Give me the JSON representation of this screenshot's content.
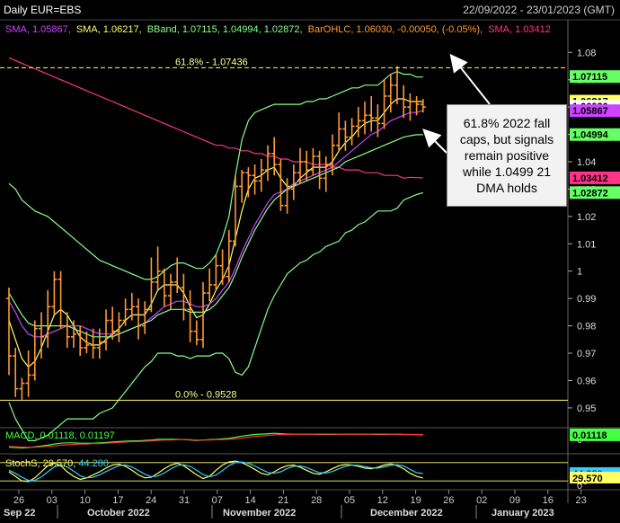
{
  "header": {
    "title": "Daily EUR=EBS",
    "date_range": "22/09/2022 - 23/01/2023 (GMT)"
  },
  "legend": [
    {
      "text": "SMA, 1.05867,",
      "color": "#cc44ff"
    },
    {
      "text": "SMA, 1.06217,",
      "color": "#ffff66"
    },
    {
      "text": "BBand, 1.07115, 1.04994, 1.02872,",
      "color": "#88ff88"
    },
    {
      "text": "BarOHLC, 1.06030, -0.00050, (-0.05%),",
      "color": "#ff9933"
    },
    {
      "text": "SMA, 1.03412",
      "color": "#ff3388"
    }
  ],
  "annotation": {
    "text": "61.8% 2022 fall caps, but signals remain positive while 1.0499 21 DMA holds"
  },
  "price_badges": [
    {
      "label": "1.07115",
      "value": 1.07115,
      "bg": "#66ff66",
      "fg": "#000000"
    },
    {
      "label": "1.06217",
      "value": 1.06217,
      "bg": "#ffff66",
      "fg": "#000000"
    },
    {
      "label": "1.06030",
      "value": 1.0603,
      "bg": "#ffffff",
      "fg": "#000000"
    },
    {
      "label": "1.05867",
      "value": 1.05867,
      "bg": "#cc44ff",
      "fg": "#000000"
    },
    {
      "label": "1.04994",
      "value": 1.04994,
      "bg": "#66ff66",
      "fg": "#000000"
    },
    {
      "label": "1.03412",
      "value": 1.03412,
      "bg": "#ff3388",
      "fg": "#000000"
    },
    {
      "label": "1.02872",
      "value": 1.02872,
      "bg": "#66ff66",
      "fg": "#000000"
    }
  ],
  "macd": {
    "label": "MACD, 0.01118, 0.01197",
    "label_color": "#44ff44",
    "value_label": "0.01118",
    "value_color": "#44ff44",
    "tick": "0"
  },
  "stoch": {
    "label_a": "StochS, 29.570,",
    "label_b": "44.280",
    "color_a": "#ffff66",
    "color_b": "#33ccff",
    "badge_a": "29.570",
    "badge_b": "44.280",
    "ticks": [
      "20",
      "0"
    ]
  },
  "colors": {
    "candles": "#ff9933",
    "sma_short": "#ffff66",
    "sma_mid": "#cc44ff",
    "sma_long": "#ff3388",
    "bband": "#88ff88",
    "fib": "#ffff66"
  },
  "chart_data": {
    "type": "line",
    "title": "Daily EUR=EBS",
    "ylim": [
      0.948,
      1.086
    ],
    "y_ticks": [
      "1.08",
      "1.07",
      "1.06",
      "1.05",
      "1.04",
      "1.03",
      "1.02",
      "1.01",
      "1",
      "0.99",
      "0.98",
      "0.97",
      "0.96",
      "0.95"
    ],
    "x_day_labels": [
      "26",
      "03",
      "10",
      "17",
      "24",
      "31",
      "07",
      "14",
      "21",
      "28",
      "05",
      "12",
      "19",
      "26",
      "02",
      "09",
      "16",
      "23"
    ],
    "x_month_labels": [
      "Sep 22",
      "October 2022",
      "November 2022",
      "December 2022",
      "January 2023"
    ],
    "fib_levels": [
      {
        "label": "61.8% - 1.07436",
        "value": 1.07436
      },
      {
        "label": "0.0% - 0.9528",
        "value": 0.9528
      }
    ],
    "ohlc": [
      [
        0.99,
        0.994,
        0.962,
        0.969
      ],
      [
        0.969,
        0.972,
        0.954,
        0.957
      ],
      [
        0.957,
        0.961,
        0.953,
        0.959
      ],
      [
        0.959,
        0.971,
        0.954,
        0.962
      ],
      [
        0.962,
        0.982,
        0.96,
        0.979
      ],
      [
        0.979,
        0.985,
        0.968,
        0.976
      ],
      [
        0.976,
        0.993,
        0.972,
        0.987
      ],
      [
        0.987,
        1.0,
        0.984,
        0.997
      ],
      [
        0.997,
        1.0,
        0.979,
        0.98
      ],
      [
        0.98,
        0.985,
        0.972,
        0.976
      ],
      [
        0.976,
        0.982,
        0.972,
        0.977
      ],
      [
        0.977,
        0.98,
        0.969,
        0.972
      ],
      [
        0.972,
        0.978,
        0.97,
        0.973
      ],
      [
        0.973,
        0.979,
        0.968,
        0.972
      ],
      [
        0.972,
        0.979,
        0.968,
        0.974
      ],
      [
        0.974,
        0.986,
        0.971,
        0.982
      ],
      [
        0.982,
        0.987,
        0.975,
        0.978
      ],
      [
        0.978,
        0.985,
        0.974,
        0.982
      ],
      [
        0.982,
        0.99,
        0.98,
        0.986
      ],
      [
        0.986,
        0.992,
        0.982,
        0.987
      ],
      [
        0.987,
        0.99,
        0.975,
        0.98
      ],
      [
        0.98,
        0.989,
        0.977,
        0.986
      ],
      [
        0.986,
        1.005,
        0.985,
        0.996
      ],
      [
        0.996,
        1.009,
        0.993,
        1.0
      ],
      [
        1.0,
        1.001,
        0.987,
        0.991
      ],
      [
        0.991,
        0.999,
        0.986,
        0.996
      ],
      [
        0.996,
        1.005,
        0.992,
        0.994
      ],
      [
        0.994,
        0.999,
        0.982,
        0.986
      ],
      [
        0.986,
        0.993,
        0.974,
        0.978
      ],
      [
        0.978,
        0.982,
        0.973,
        0.975
      ],
      [
        0.975,
        0.996,
        0.972,
        0.992
      ],
      [
        0.992,
        1.001,
        0.989,
        0.995
      ],
      [
        0.995,
        1.006,
        0.993,
        1.002
      ],
      [
        1.002,
        1.008,
        0.995,
        0.998
      ],
      [
        0.998,
        1.015,
        0.996,
        1.011
      ],
      [
        1.011,
        1.035,
        1.009,
        1.031
      ],
      [
        1.031,
        1.037,
        1.025,
        1.036
      ],
      [
        1.036,
        1.038,
        1.027,
        1.035
      ],
      [
        1.035,
        1.039,
        1.028,
        1.033
      ],
      [
        1.033,
        1.041,
        1.029,
        1.037
      ],
      [
        1.037,
        1.046,
        1.033,
        1.043
      ],
      [
        1.043,
        1.049,
        1.035,
        1.039
      ],
      [
        1.039,
        1.041,
        1.022,
        1.024
      ],
      [
        1.024,
        1.034,
        1.021,
        1.03
      ],
      [
        1.03,
        1.039,
        1.026,
        1.036
      ],
      [
        1.036,
        1.045,
        1.032,
        1.04
      ],
      [
        1.04,
        1.044,
        1.033,
        1.037
      ],
      [
        1.037,
        1.045,
        1.035,
        1.042
      ],
      [
        1.042,
        1.044,
        1.03,
        1.034
      ],
      [
        1.034,
        1.042,
        1.029,
        1.039
      ],
      [
        1.039,
        1.05,
        1.035,
        1.046
      ],
      [
        1.046,
        1.058,
        1.044,
        1.052
      ],
      [
        1.052,
        1.055,
        1.044,
        1.049
      ],
      [
        1.049,
        1.056,
        1.046,
        1.053
      ],
      [
        1.053,
        1.06,
        1.049,
        1.055
      ],
      [
        1.055,
        1.062,
        1.05,
        1.057
      ],
      [
        1.057,
        1.064,
        1.051,
        1.056
      ],
      [
        1.056,
        1.061,
        1.049,
        1.054
      ],
      [
        1.054,
        1.07,
        1.052,
        1.064
      ],
      [
        1.064,
        1.072,
        1.058,
        1.068
      ],
      [
        1.068,
        1.075,
        1.061,
        1.063
      ],
      [
        1.063,
        1.068,
        1.056,
        1.06
      ],
      [
        1.06,
        1.065,
        1.055,
        1.062
      ],
      [
        1.062,
        1.064,
        1.057,
        1.061
      ],
      [
        1.061,
        1.063,
        1.058,
        1.06
      ]
    ],
    "series": [
      {
        "name": "SMA, 1.06217",
        "color": "#ffff66",
        "values": [
          0.982,
          0.975,
          0.968,
          0.965,
          0.967,
          0.972,
          0.978,
          0.984,
          0.986,
          0.984,
          0.98,
          0.976,
          0.974,
          0.973,
          0.973,
          0.975,
          0.977,
          0.979,
          0.982,
          0.984,
          0.984,
          0.984,
          0.988,
          0.993,
          0.995,
          0.995,
          0.995,
          0.992,
          0.987,
          0.983,
          0.984,
          0.988,
          0.993,
          0.997,
          1.002,
          1.012,
          1.022,
          1.03,
          1.034,
          1.035,
          1.037,
          1.038,
          1.034,
          1.031,
          1.031,
          1.034,
          1.036,
          1.038,
          1.038,
          1.038,
          1.04,
          1.044,
          1.047,
          1.049,
          1.052,
          1.054,
          1.055,
          1.055,
          1.058,
          1.061,
          1.063,
          1.063,
          1.062,
          1.062,
          1.062
        ]
      },
      {
        "name": "SMA, 1.05867",
        "color": "#cc44ff",
        "values": [
          0.989,
          0.985,
          0.98,
          0.977,
          0.976,
          0.976,
          0.977,
          0.978,
          0.979,
          0.98,
          0.98,
          0.98,
          0.979,
          0.978,
          0.977,
          0.977,
          0.977,
          0.977,
          0.978,
          0.979,
          0.98,
          0.981,
          0.983,
          0.985,
          0.987,
          0.988,
          0.989,
          0.989,
          0.988,
          0.987,
          0.987,
          0.988,
          0.99,
          0.993,
          0.996,
          1.001,
          1.007,
          1.012,
          1.017,
          1.021,
          1.025,
          1.028,
          1.029,
          1.03,
          1.032,
          1.033,
          1.034,
          1.035,
          1.036,
          1.037,
          1.038,
          1.04,
          1.042,
          1.044,
          1.046,
          1.048,
          1.05,
          1.051,
          1.053,
          1.055,
          1.056,
          1.057,
          1.058,
          1.058,
          1.0587
        ]
      },
      {
        "name": "SMA, 1.03412",
        "color": "#ff3388",
        "values": [
          1.078,
          1.077,
          1.076,
          1.075,
          1.074,
          1.073,
          1.072,
          1.071,
          1.07,
          1.069,
          1.068,
          1.067,
          1.066,
          1.065,
          1.064,
          1.063,
          1.062,
          1.061,
          1.06,
          1.059,
          1.058,
          1.057,
          1.056,
          1.055,
          1.054,
          1.053,
          1.052,
          1.051,
          1.05,
          1.049,
          1.048,
          1.047,
          1.046,
          1.046,
          1.045,
          1.045,
          1.044,
          1.044,
          1.043,
          1.043,
          1.042,
          1.042,
          1.041,
          1.041,
          1.04,
          1.04,
          1.04,
          1.039,
          1.039,
          1.039,
          1.038,
          1.038,
          1.037,
          1.037,
          1.037,
          1.036,
          1.036,
          1.036,
          1.035,
          1.035,
          1.035,
          1.034,
          1.0343,
          1.0342,
          1.0341
        ]
      },
      {
        "name": "BBand upper",
        "color": "#88ff88",
        "values": [
          1.032,
          1.03,
          1.026,
          1.024,
          1.022,
          1.021,
          1.02,
          1.018,
          1.016,
          1.014,
          1.012,
          1.01,
          1.008,
          1.006,
          1.004,
          1.003,
          1.002,
          1.001,
          1.0,
          0.999,
          0.998,
          0.997,
          0.997,
          0.998,
          1.0,
          1.002,
          1.003,
          1.003,
          1.002,
          1.001,
          1.001,
          1.003,
          1.006,
          1.012,
          1.02,
          1.035,
          1.048,
          1.055,
          1.058,
          1.059,
          1.06,
          1.061,
          1.061,
          1.061,
          1.061,
          1.061,
          1.062,
          1.062,
          1.063,
          1.063,
          1.064,
          1.065,
          1.066,
          1.067,
          1.067,
          1.068,
          1.068,
          1.068,
          1.07,
          1.072,
          1.073,
          1.072,
          1.072,
          1.071,
          1.071
        ]
      },
      {
        "name": "BBand middle",
        "color": "#88ff88",
        "values": [
          0.992,
          0.988,
          0.984,
          0.981,
          0.98,
          0.98,
          0.98,
          0.98,
          0.98,
          0.98,
          0.979,
          0.978,
          0.977,
          0.976,
          0.976,
          0.976,
          0.976,
          0.977,
          0.978,
          0.979,
          0.98,
          0.981,
          0.982,
          0.984,
          0.985,
          0.986,
          0.986,
          0.986,
          0.985,
          0.985,
          0.985,
          0.986,
          0.988,
          0.991,
          0.994,
          0.999,
          1.005,
          1.01,
          1.015,
          1.019,
          1.023,
          1.026,
          1.028,
          1.03,
          1.031,
          1.032,
          1.033,
          1.034,
          1.035,
          1.036,
          1.037,
          1.038,
          1.04,
          1.041,
          1.042,
          1.043,
          1.044,
          1.045,
          1.046,
          1.047,
          1.048,
          1.049,
          1.0495,
          1.0499,
          1.0499
        ]
      },
      {
        "name": "BBand lower",
        "color": "#88ff88",
        "values": [
          0.952,
          0.946,
          0.942,
          0.938,
          0.938,
          0.939,
          0.94,
          0.942,
          0.944,
          0.946,
          0.946,
          0.946,
          0.946,
          0.946,
          0.948,
          0.949,
          0.95,
          0.953,
          0.956,
          0.959,
          0.962,
          0.965,
          0.967,
          0.97,
          0.97,
          0.97,
          0.969,
          0.969,
          0.968,
          0.969,
          0.969,
          0.969,
          0.97,
          0.97,
          0.968,
          0.963,
          0.962,
          0.965,
          0.972,
          0.979,
          0.986,
          0.991,
          0.995,
          0.999,
          1.001,
          1.003,
          1.004,
          1.006,
          1.007,
          1.009,
          1.01,
          1.011,
          1.014,
          1.015,
          1.017,
          1.018,
          1.02,
          1.022,
          1.022,
          1.022,
          1.023,
          1.026,
          1.027,
          1.028,
          1.0287
        ]
      }
    ],
    "macd_series": [
      {
        "name": "MACD",
        "color": "#44ff44",
        "values": [
          -0.02,
          -0.021,
          -0.022,
          -0.021,
          -0.019,
          -0.017,
          -0.015,
          -0.012,
          -0.01,
          -0.009,
          -0.009,
          -0.01,
          -0.01,
          -0.01,
          -0.009,
          -0.008,
          -0.007,
          -0.006,
          -0.005,
          -0.004,
          -0.004,
          -0.003,
          -0.002,
          0.0,
          0.0,
          0.0,
          0.0,
          -0.001,
          -0.002,
          -0.003,
          -0.002,
          -0.001,
          0.0,
          0.001,
          0.002,
          0.005,
          0.008,
          0.01,
          0.012,
          0.013,
          0.014,
          0.015,
          0.014,
          0.013,
          0.013,
          0.013,
          0.013,
          0.013,
          0.012,
          0.012,
          0.012,
          0.013,
          0.013,
          0.013,
          0.013,
          0.013,
          0.013,
          0.012,
          0.012,
          0.013,
          0.013,
          0.012,
          0.012,
          0.0115,
          0.01118
        ]
      },
      {
        "name": "Signal",
        "color": "#ff3333",
        "values": [
          -0.018,
          -0.019,
          -0.02,
          -0.02,
          -0.02,
          -0.019,
          -0.018,
          -0.017,
          -0.015,
          -0.014,
          -0.013,
          -0.012,
          -0.012,
          -0.011,
          -0.011,
          -0.01,
          -0.009,
          -0.008,
          -0.007,
          -0.006,
          -0.006,
          -0.005,
          -0.004,
          -0.003,
          -0.002,
          -0.002,
          -0.001,
          -0.001,
          -0.001,
          -0.002,
          -0.002,
          -0.002,
          -0.001,
          -0.001,
          0.0,
          0.001,
          0.003,
          0.005,
          0.007,
          0.008,
          0.01,
          0.011,
          0.012,
          0.012,
          0.013,
          0.013,
          0.013,
          0.013,
          0.013,
          0.013,
          0.013,
          0.013,
          0.013,
          0.013,
          0.013,
          0.013,
          0.013,
          0.013,
          0.013,
          0.013,
          0.013,
          0.012,
          0.012,
          0.012,
          0.01197
        ]
      }
    ],
    "stoch_series": [
      {
        "name": "StochS %K",
        "color": "#ffff66",
        "values": [
          50,
          35,
          20,
          18,
          30,
          50,
          70,
          78,
          70,
          50,
          35,
          25,
          30,
          40,
          50,
          62,
          72,
          75,
          68,
          55,
          40,
          30,
          32,
          45,
          60,
          72,
          78,
          70,
          55,
          40,
          28,
          35,
          55,
          72,
          82,
          85,
          80,
          70,
          58,
          45,
          40,
          50,
          62,
          70,
          72,
          65,
          55,
          45,
          42,
          50,
          60,
          70,
          74,
          72,
          68,
          62,
          60,
          65,
          72,
          76,
          70,
          60,
          45,
          35,
          29.57
        ]
      },
      {
        "name": "StochS %D",
        "color": "#33ccff",
        "values": [
          55,
          45,
          32,
          22,
          22,
          33,
          50,
          66,
          73,
          66,
          52,
          37,
          30,
          32,
          40,
          51,
          61,
          70,
          72,
          66,
          54,
          42,
          34,
          36,
          46,
          59,
          70,
          73,
          68,
          55,
          41,
          34,
          39,
          54,
          70,
          80,
          82,
          78,
          69,
          58,
          48,
          45,
          50,
          61,
          68,
          69,
          64,
          55,
          47,
          46,
          51,
          60,
          68,
          72,
          71,
          67,
          63,
          62,
          66,
          71,
          73,
          69,
          58,
          47,
          44.28
        ]
      }
    ]
  }
}
